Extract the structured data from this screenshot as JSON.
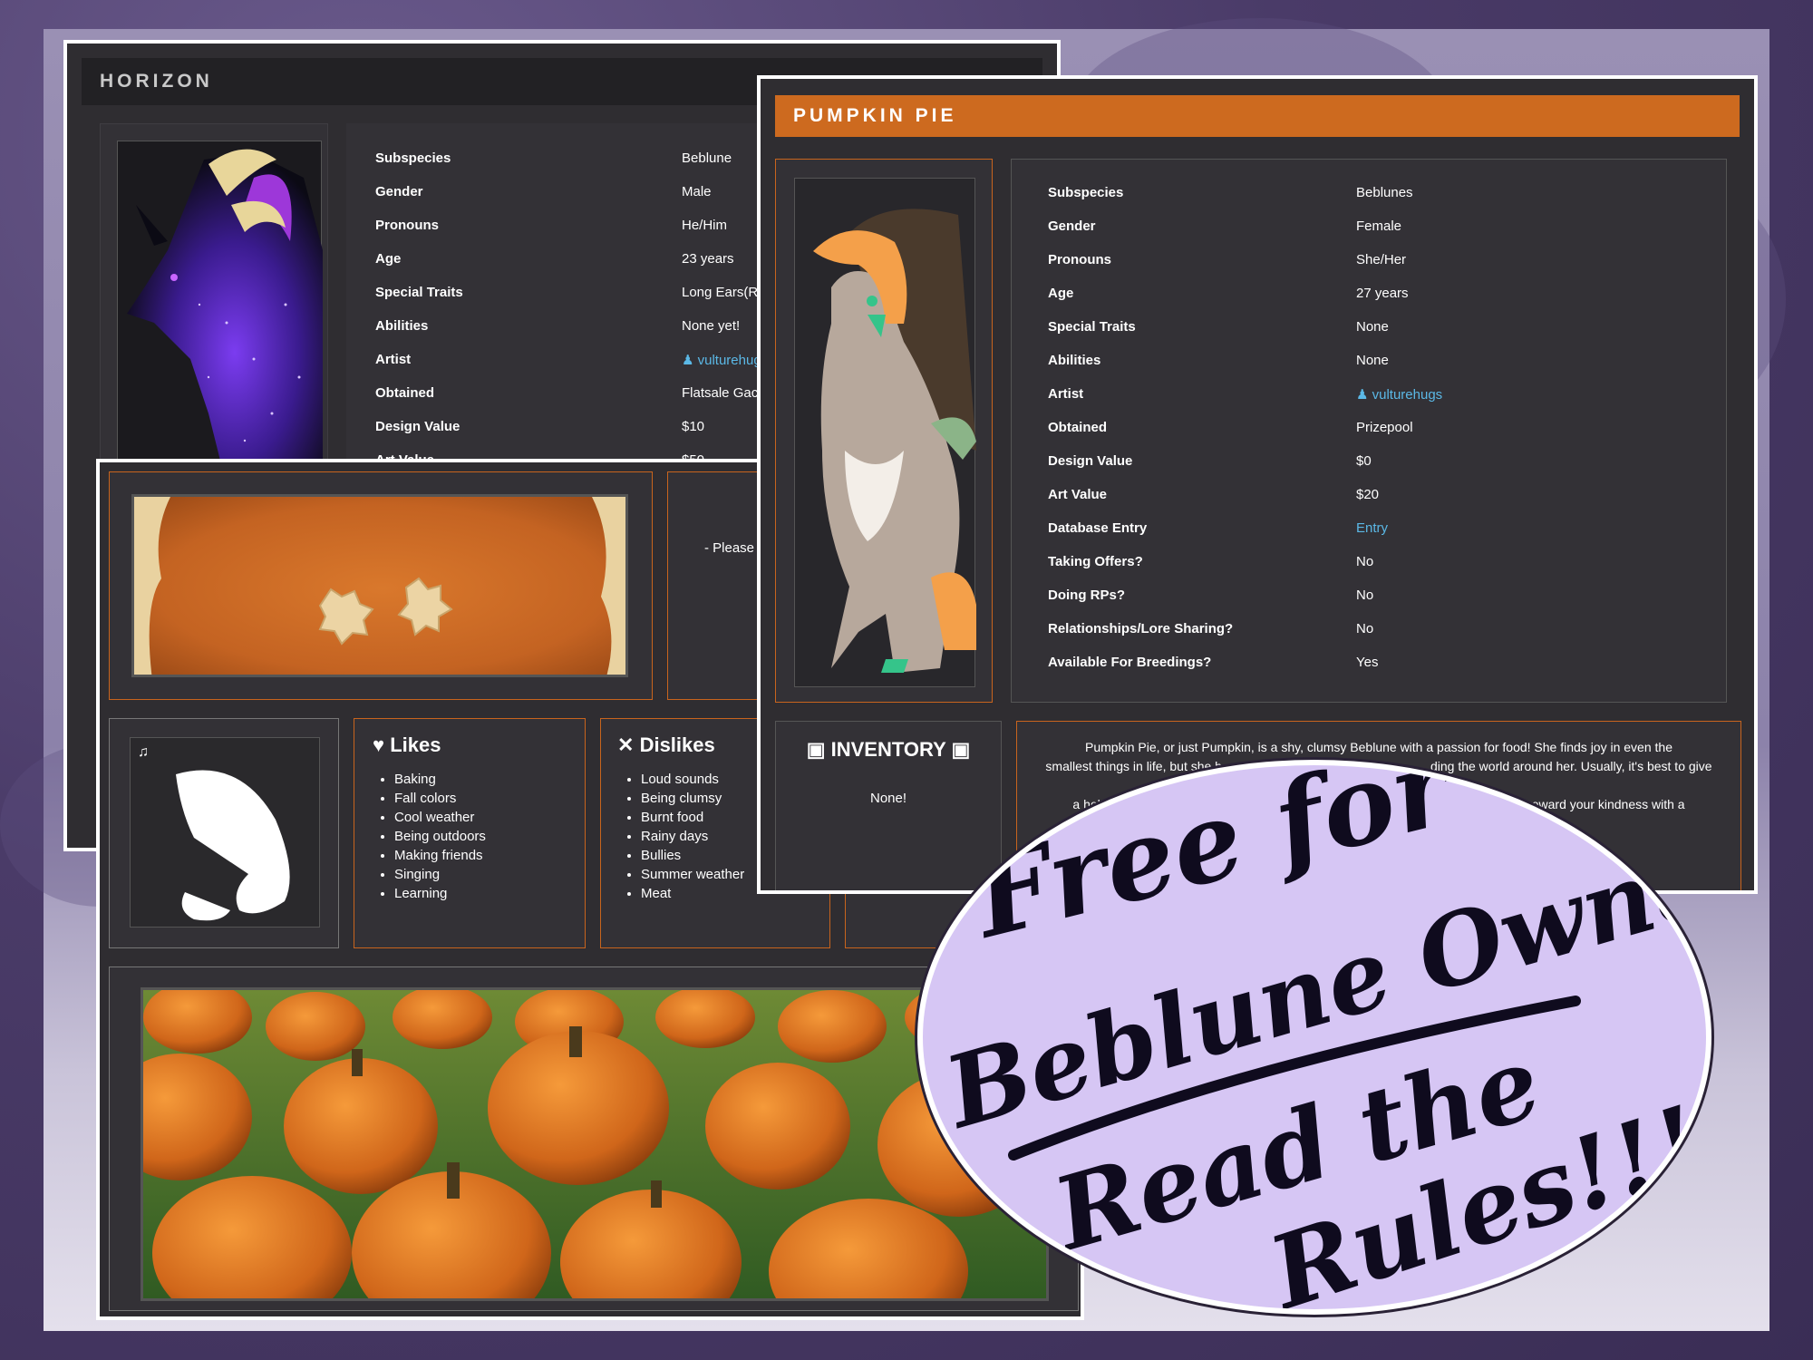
{
  "horizon": {
    "title": "HORIZON",
    "fields": [
      {
        "label": "Subspecies",
        "value": "Beblune"
      },
      {
        "label": "Gender",
        "value": "Male"
      },
      {
        "label": "Pronouns",
        "value": "He/Him"
      },
      {
        "label": "Age",
        "value": "23 years"
      },
      {
        "label": "Special Traits",
        "value": "Long Ears(R"
      },
      {
        "label": "Abilities",
        "value": "None yet!"
      },
      {
        "label": "Artist",
        "value": "vulturehug"
      },
      {
        "label": "Obtained",
        "value": "Flatsale Gac"
      },
      {
        "label": "Design Value",
        "value": "$10"
      },
      {
        "label": "Art Value",
        "value": "$50"
      }
    ]
  },
  "lower": {
    "note_text": "- Please c",
    "likes": {
      "title": "Likes",
      "items": [
        "Baking",
        "Fall colors",
        "Cool weather",
        "Being outdoors",
        "Making friends",
        "Singing",
        "Learning"
      ]
    },
    "dislikes": {
      "title": "Dislikes",
      "items": [
        "Loud sounds",
        "Being clumsy",
        "Burnt food",
        "Rainy days",
        "Bullies",
        "Summer weather",
        "Meat"
      ]
    }
  },
  "pumpkin": {
    "title": "PUMPKIN PIE",
    "fields": [
      {
        "label": "Subspecies",
        "value": "Beblunes"
      },
      {
        "label": "Gender",
        "value": "Female"
      },
      {
        "label": "Pronouns",
        "value": "She/Her"
      },
      {
        "label": "Age",
        "value": "27 years"
      },
      {
        "label": "Special Traits",
        "value": "None"
      },
      {
        "label": "Abilities",
        "value": "None"
      },
      {
        "label": "Artist",
        "value": "vulturehugs"
      },
      {
        "label": "Obtained",
        "value": "Prizepool"
      },
      {
        "label": "Design Value",
        "value": "$0"
      },
      {
        "label": "Art Value",
        "value": "$20"
      },
      {
        "label": "Database Entry",
        "value": "Entry"
      },
      {
        "label": "Taking Offers?",
        "value": "No"
      },
      {
        "label": "Doing RPs?",
        "value": "No"
      },
      {
        "label": "Relationships/Lore Sharing?",
        "value": "No"
      },
      {
        "label": "Available For Breedings?",
        "value": "Yes"
      }
    ],
    "inventory_title": "INVENTORY",
    "inventory_value": "None!",
    "bio_lines": [
      "Pumpkin Pie, or just Pumpkin, is a shy, clumsy Beblune with a passion for food! She finds joy in even the",
      "smallest things in life, but she h",
      "a helping hand"
    ],
    "bio_tail_1": "ding the world around her. Usually, it's best to give her",
    "bio_tail_2": "e might reward your kindness with a"
  },
  "sticker": {
    "line1": "Free for",
    "line2": "Beblune Owners",
    "line3": "Read the",
    "line4": "Rules!!!"
  },
  "colors": {
    "accent_orange": "#cd6a1f",
    "panel_bg": "#2f2d31",
    "link_blue": "#5bb8e6",
    "sticker_bg": "#d6c6f4"
  }
}
